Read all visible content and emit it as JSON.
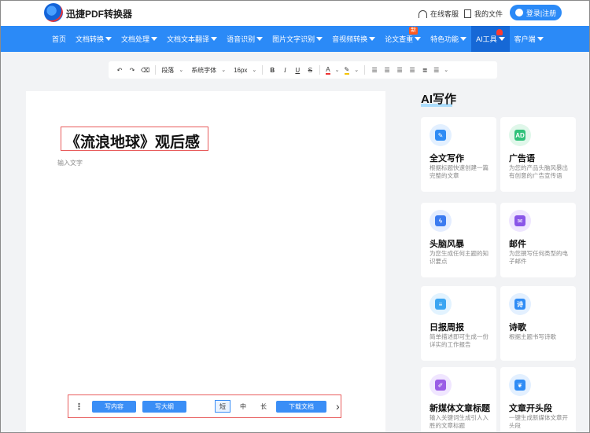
{
  "header": {
    "app_name": "迅捷PDF转换器",
    "service_link": "在线客服",
    "my_files_link": "我的文件",
    "login_label": "登录|注册"
  },
  "nav": {
    "items": [
      {
        "label": "首页",
        "has_caret": false
      },
      {
        "label": "文档转换",
        "has_caret": true
      },
      {
        "label": "文档处理",
        "has_caret": true
      },
      {
        "label": "文档文本翻译",
        "has_caret": true
      },
      {
        "label": "语音识别",
        "has_caret": true
      },
      {
        "label": "图片文字识别",
        "has_caret": true
      },
      {
        "label": "音视频转换",
        "has_caret": true
      },
      {
        "label": "论文查重",
        "has_caret": true,
        "badge": "新"
      },
      {
        "label": "特色功能",
        "has_caret": true
      },
      {
        "label": "AI工具",
        "has_caret": true,
        "active": true,
        "hot": true
      },
      {
        "label": "客户端",
        "has_caret": true
      }
    ]
  },
  "toolbar": {
    "undo_icon": "undo-icon",
    "redo_icon": "redo-icon",
    "eraser_icon": "eraser-icon",
    "paragraph_label": "段落",
    "font_label": "系统字体",
    "size_label": "16px",
    "bold": "B",
    "italic": "I",
    "underline": "U",
    "strike": "S",
    "font_color": "A"
  },
  "document": {
    "title": "《流浪地球》观后感",
    "placeholder": "输入文字",
    "actions": {
      "write_content": "写内容",
      "write_outline": "写大纲",
      "length_short": "短",
      "length_medium": "中",
      "length_long": "长",
      "download": "下载文档"
    }
  },
  "ai_panel": {
    "title": "AI写作",
    "cards": [
      {
        "name": "全文写作",
        "desc": "根据标题快速创建一篇完整的文章",
        "icon": "doc-edit-icon",
        "color": "#2f8cf5",
        "bg": "#e3f0ff",
        "glyph": "✎"
      },
      {
        "name": "广告语",
        "desc": "为您的产品头脑风暴出有创意的广告宣传语",
        "icon": "ad-icon",
        "color": "#2fc27a",
        "bg": "#e0f7ea",
        "glyph": "AD"
      },
      {
        "name": "头脑风暴",
        "desc": "为您生成任何主题的知识要点",
        "icon": "lightning-icon",
        "color": "#3c7bf0",
        "bg": "#e4edff",
        "glyph": "ϟ"
      },
      {
        "name": "邮件",
        "desc": "为您撰写任何类型的电子邮件",
        "icon": "mail-icon",
        "color": "#8a56e8",
        "bg": "#efe6ff",
        "glyph": "✉"
      },
      {
        "name": "日报周报",
        "desc": "简单描述即可生成一份详实的工作报告",
        "icon": "report-icon",
        "color": "#3aa5f2",
        "bg": "#e2f3ff",
        "glyph": "≡"
      },
      {
        "name": "诗歌",
        "desc": "根据主题书写诗歌",
        "icon": "poem-icon",
        "color": "#2f8cf5",
        "bg": "#e3f0ff",
        "glyph": "诗"
      },
      {
        "name": "新媒体文章标题",
        "desc": "输入关键词生成引人入胜的文章标题",
        "icon": "pen-icon",
        "color": "#9a5ce6",
        "bg": "#f0e6ff",
        "glyph": "✐"
      },
      {
        "name": "文章开头段",
        "desc": "一键生成新媒体文章开头段",
        "icon": "leaf-icon",
        "color": "#2f8cf5",
        "bg": "#e3f0ff",
        "glyph": "❦"
      }
    ]
  }
}
